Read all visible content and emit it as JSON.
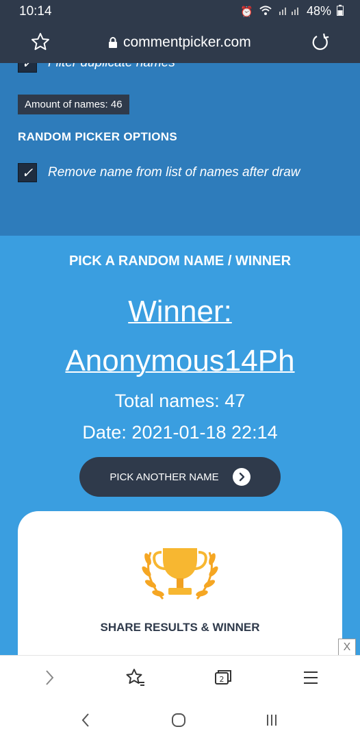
{
  "status_bar": {
    "time": "10:14",
    "battery": "48%"
  },
  "browser": {
    "url": "commentpicker.com"
  },
  "settings": {
    "cut_option_label": "Filter duplicate names",
    "amount_badge": "Amount of names: 46",
    "random_picker_title": "RANDOM PICKER OPTIONS",
    "remove_name_label": "Remove name from list of names after draw"
  },
  "winner": {
    "section_title": "PICK A RANDOM NAME / WINNER",
    "label": "Winner:",
    "name": "Anonymous14Ph",
    "total": "Total names: 47",
    "date": "Date: 2021-01-18 22:14",
    "button_label": "PICK ANOTHER NAME"
  },
  "share": {
    "title": "SHARE RESULTS & WINNER"
  },
  "ad": {
    "close_label": "X"
  },
  "bottom_toolbar": {
    "tab_count": "2"
  }
}
